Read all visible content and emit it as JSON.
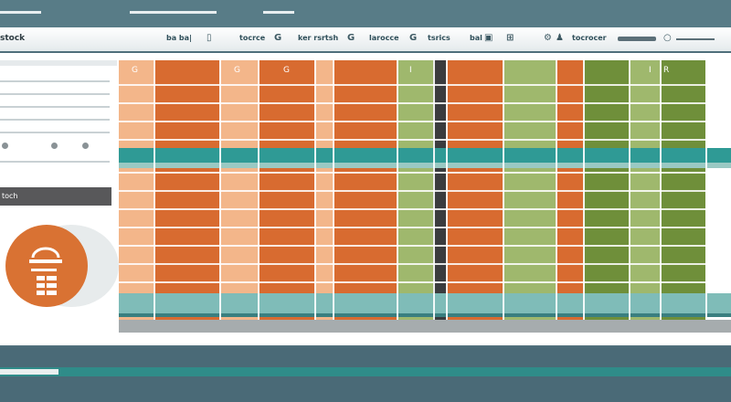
{
  "app": {
    "title": "stock"
  },
  "menu": {
    "items": [
      {
        "label": "ba ba|",
        "icon": "doc-icon"
      },
      {
        "label": "tocrce",
        "icon": "g-icon"
      },
      {
        "label": "ker rsrtsh",
        "icon": "g-icon"
      },
      {
        "label": "larocce",
        "icon": "g-icon"
      },
      {
        "label": "tsrics",
        "icon": "box-icon"
      },
      {
        "label": "bal",
        "icon": "grid-icon"
      },
      {
        "label": "tocrocer",
        "icon": "bell-icon"
      }
    ]
  },
  "sidebar": {
    "search_label": "toch",
    "icon": "lock-building-icon"
  },
  "colors": {
    "orange": "#d86b30",
    "light_orange": "#f3b68a",
    "green": "#9fb86d",
    "olive": "#6f8f3a",
    "teal": "#2f9a95",
    "charcoal": "#3b3c3e"
  },
  "grid": {
    "column_colors": [
      "light_orange",
      "orange",
      "light_orange",
      "orange",
      "light_orange",
      "orange",
      "green",
      "charcoal",
      "orange",
      "green",
      "orange",
      "olive",
      "green",
      "olive"
    ],
    "header_icons": [
      "G",
      "G",
      "G",
      "I",
      "I",
      "R"
    ]
  },
  "progress": {
    "value": 0.08
  }
}
